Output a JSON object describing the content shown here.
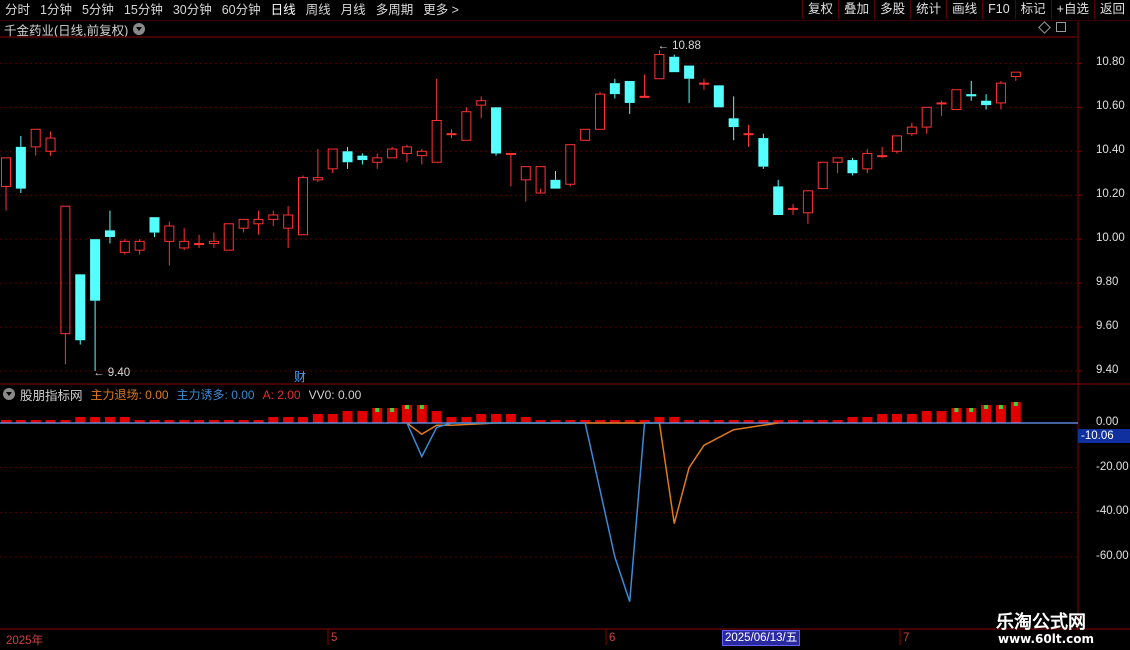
{
  "toolbar": {
    "periods": [
      "分时",
      "1分钟",
      "5分钟",
      "15分钟",
      "30分钟",
      "60分钟",
      "日线",
      "周线",
      "月线",
      "多周期",
      "更多 >"
    ],
    "active_period": "日线",
    "buttons": [
      "复权",
      "叠加",
      "多股",
      "统计",
      "画线",
      "F10",
      "标记",
      "+自选",
      "返回"
    ]
  },
  "main_chart": {
    "title": "千金药业(日线,前复权)",
    "high_label": "10.88",
    "low_label": "9.40",
    "finance_marker": "财",
    "axis_labels": [
      "10.80",
      "10.60",
      "10.40",
      "10.20",
      "10.00",
      "9.80",
      "9.60",
      "9.40"
    ]
  },
  "sub_chart": {
    "name": "股朋指标网",
    "legend": [
      {
        "text": "主力退场: 0.00",
        "color": "#e07a20"
      },
      {
        "text": "主力诱多: 0.00",
        "color": "#3a8ad8"
      },
      {
        "text": "A: 2.00",
        "color": "#e03030"
      },
      {
        "text": "VV0: 0.00",
        "color": "#d0d0d0"
      }
    ],
    "axis_labels": [
      "0.00",
      "-20.00",
      "-40.00",
      "-60.00"
    ],
    "current_value": "-10.06"
  },
  "date_axis": {
    "labels": [
      "2025年",
      "5",
      "6",
      "7"
    ],
    "cursor_date": "2025/06/13/五"
  },
  "watermark": {
    "title": "乐淘公式网",
    "url": "www.60lt.com"
  },
  "colors": {
    "up": "#ff3232",
    "down": "#54ffff",
    "grid": "#5a0000",
    "axis": "#8b0000"
  },
  "chart_data": {
    "type": "candlestick",
    "ylim": [
      9.35,
      10.92
    ],
    "candles": [
      [
        10.24,
        10.37,
        10.13,
        10.37
      ],
      [
        10.42,
        10.23,
        10.21,
        10.47
      ],
      [
        10.42,
        10.5,
        10.38,
        10.5
      ],
      [
        10.4,
        10.46,
        10.38,
        10.49
      ],
      [
        9.57,
        10.15,
        9.43,
        10.15
      ],
      [
        9.84,
        9.54,
        9.52,
        9.84
      ],
      [
        10.0,
        9.72,
        9.4,
        10.0
      ],
      [
        10.04,
        10.01,
        9.98,
        10.13
      ],
      [
        9.94,
        9.99,
        9.93,
        10.0
      ],
      [
        9.95,
        9.99,
        9.93,
        10.0
      ],
      [
        10.1,
        10.03,
        10.01,
        10.1
      ],
      [
        9.99,
        10.06,
        9.88,
        10.08
      ],
      [
        9.96,
        9.99,
        9.95,
        10.05
      ],
      [
        9.98,
        9.98,
        9.96,
        10.02
      ],
      [
        9.98,
        9.99,
        9.96,
        10.03
      ],
      [
        9.95,
        10.07,
        9.95,
        10.07
      ],
      [
        10.05,
        10.09,
        10.03,
        10.09
      ],
      [
        10.07,
        10.09,
        10.02,
        10.13
      ],
      [
        10.09,
        10.11,
        10.06,
        10.13
      ],
      [
        10.05,
        10.11,
        9.96,
        10.15
      ],
      [
        10.02,
        10.28,
        10.02,
        10.29
      ],
      [
        10.27,
        10.28,
        10.26,
        10.41
      ],
      [
        10.32,
        10.41,
        10.3,
        10.41
      ],
      [
        10.4,
        10.35,
        10.32,
        10.42
      ],
      [
        10.38,
        10.36,
        10.34,
        10.39
      ],
      [
        10.35,
        10.37,
        10.32,
        10.39
      ],
      [
        10.37,
        10.41,
        10.37,
        10.42
      ],
      [
        10.39,
        10.42,
        10.35,
        10.43
      ],
      [
        10.38,
        10.4,
        10.34,
        10.41
      ],
      [
        10.35,
        10.54,
        10.35,
        10.73
      ],
      [
        10.48,
        10.48,
        10.46,
        10.5
      ],
      [
        10.45,
        10.58,
        10.45,
        10.6
      ],
      [
        10.61,
        10.63,
        10.55,
        10.65
      ],
      [
        10.6,
        10.39,
        10.38,
        10.6
      ],
      [
        10.39,
        10.39,
        10.24,
        10.39
      ],
      [
        10.27,
        10.33,
        10.17,
        10.33
      ],
      [
        10.21,
        10.33,
        10.23,
        10.33
      ],
      [
        10.27,
        10.23,
        10.26,
        10.31
      ],
      [
        10.25,
        10.43,
        10.24,
        10.43
      ],
      [
        10.45,
        10.5,
        10.45,
        10.5
      ],
      [
        10.5,
        10.66,
        10.5,
        10.67
      ],
      [
        10.71,
        10.66,
        10.64,
        10.73
      ],
      [
        10.72,
        10.62,
        10.57,
        10.72
      ],
      [
        10.65,
        10.65,
        10.65,
        10.75
      ],
      [
        10.73,
        10.84,
        10.73,
        10.86
      ],
      [
        10.83,
        10.76,
        10.76,
        10.84
      ],
      [
        10.79,
        10.73,
        10.62,
        10.79
      ],
      [
        10.71,
        10.71,
        10.68,
        10.73
      ],
      [
        10.7,
        10.6,
        10.6,
        10.7
      ],
      [
        10.55,
        10.51,
        10.45,
        10.65
      ],
      [
        10.48,
        10.48,
        10.42,
        10.52
      ],
      [
        10.46,
        10.33,
        10.32,
        10.48
      ],
      [
        10.24,
        10.11,
        10.11,
        10.27
      ],
      [
        10.14,
        10.14,
        10.11,
        10.16
      ],
      [
        10.12,
        10.22,
        10.07,
        10.22
      ],
      [
        10.23,
        10.35,
        10.23,
        10.35
      ],
      [
        10.35,
        10.37,
        10.3,
        10.37
      ],
      [
        10.36,
        10.3,
        10.29,
        10.37
      ],
      [
        10.32,
        10.39,
        10.3,
        10.41
      ],
      [
        10.38,
        10.38,
        10.37,
        10.42
      ],
      [
        10.4,
        10.47,
        10.39,
        10.47
      ],
      [
        10.48,
        10.51,
        10.47,
        10.53
      ],
      [
        10.51,
        10.6,
        10.48,
        10.6
      ],
      [
        10.62,
        10.62,
        10.56,
        10.63
      ],
      [
        10.59,
        10.68,
        10.59,
        10.68
      ],
      [
        10.66,
        10.65,
        10.63,
        10.72
      ],
      [
        10.63,
        10.61,
        10.59,
        10.66
      ],
      [
        10.62,
        10.71,
        10.59,
        10.72
      ],
      [
        10.74,
        10.76,
        10.72,
        10.76
      ]
    ],
    "sub_series": {
      "A_bars": [
        1,
        1,
        1,
        1,
        1,
        2,
        2,
        2,
        2,
        1,
        1,
        1,
        1,
        1,
        1,
        1,
        1,
        1,
        2,
        2,
        2,
        3,
        3,
        4,
        4,
        5,
        5,
        6,
        6,
        4,
        2,
        2,
        3,
        3,
        3,
        2,
        1,
        1,
        1,
        1,
        1,
        1,
        1,
        1,
        2,
        2,
        1,
        1,
        1,
        1,
        1,
        1,
        1,
        1,
        1,
        1,
        1,
        2,
        2,
        3,
        3,
        3,
        4,
        4,
        5,
        5,
        6,
        6,
        7
      ],
      "blue_line": [
        [
          27,
          0
        ],
        [
          28,
          -15
        ],
        [
          29,
          -2
        ],
        [
          30,
          0
        ],
        [
          39,
          0
        ],
        [
          41,
          -60
        ],
        [
          42,
          -80
        ],
        [
          43,
          0
        ],
        [
          44,
          0
        ]
      ],
      "orange_line": [
        [
          27,
          0
        ],
        [
          28,
          -5
        ],
        [
          29,
          -1
        ],
        [
          30,
          -1
        ],
        [
          33,
          0
        ],
        [
          44,
          0
        ],
        [
          45,
          -45
        ],
        [
          46,
          -20
        ],
        [
          47,
          -10
        ],
        [
          49,
          -3
        ],
        [
          52,
          0
        ]
      ]
    }
  }
}
